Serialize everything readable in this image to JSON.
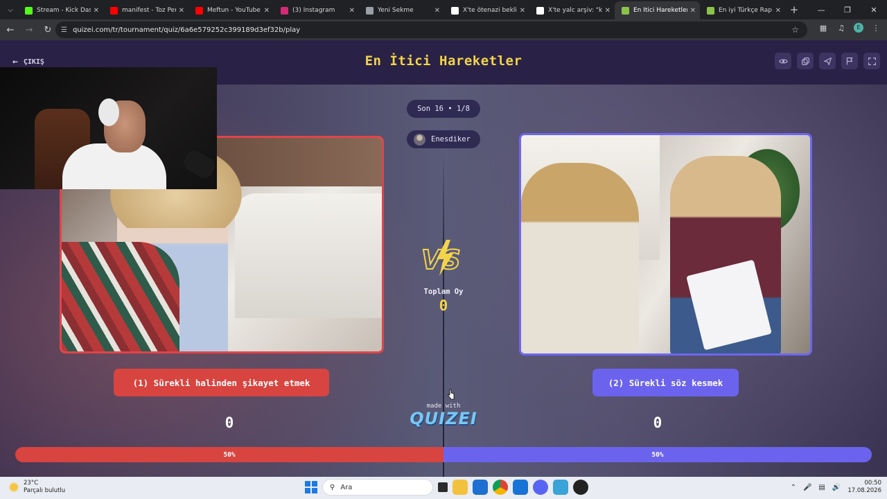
{
  "browser": {
    "tabs": [
      {
        "title": "Stream - Kick Dashbo",
        "fav_color": "#53fc18",
        "active": false
      },
      {
        "title": "manifest - Toz Pembe",
        "fav_color": "#ff0000",
        "active": false
      },
      {
        "title": "Meftun - YouTube",
        "fav_color": "#ff0000",
        "active": false
      },
      {
        "title": "(3) Instagram",
        "fav_color": "#d62976",
        "active": false
      },
      {
        "title": "Yeni Sekme",
        "fav_color": "#9aa0a6",
        "active": false
      },
      {
        "title": "X'te ötenazi bekliyor",
        "fav_color": "#ffffff",
        "active": false
      },
      {
        "title": "X'te yalc arşiv: \"kurtla",
        "fav_color": "#ffffff",
        "active": false
      },
      {
        "title": "En İtici Hareketler - T",
        "fav_color": "#8bc34a",
        "active": true
      },
      {
        "title": "En iyi Türkçe Rap Şar",
        "fav_color": "#8bc34a",
        "active": false
      }
    ],
    "new_tab": "+",
    "url": "quizei.com/tr/tournament/quiz/6a6e579252c399189d3ef32b/play",
    "profile_initial": "E"
  },
  "header": {
    "exit_label": "ÇIKIŞ",
    "title": "En İtici Hareketler"
  },
  "round": {
    "label": "Son 16 • 1/8",
    "user": "Enesdiker"
  },
  "center": {
    "vs": "VS",
    "total_label": "Toplam Oy",
    "total_value": "0",
    "made_with": "made with",
    "brand": "QUIZEI"
  },
  "options": {
    "left": {
      "label": "(1) Sürekli halinden şikayet etmek",
      "score": "0",
      "percent_label": "50%",
      "share": 50,
      "color": "#d8443f"
    },
    "right": {
      "label": "(2) Sürekli söz kesmek",
      "score": "0",
      "percent_label": "50%",
      "share": 50,
      "color": "#6b63ee"
    }
  },
  "taskbar": {
    "weather_temp": "23°C",
    "weather_desc": "Parçalı bulutlu",
    "search_label": "Ara",
    "time": "00:50",
    "date": "17.08.2026"
  }
}
